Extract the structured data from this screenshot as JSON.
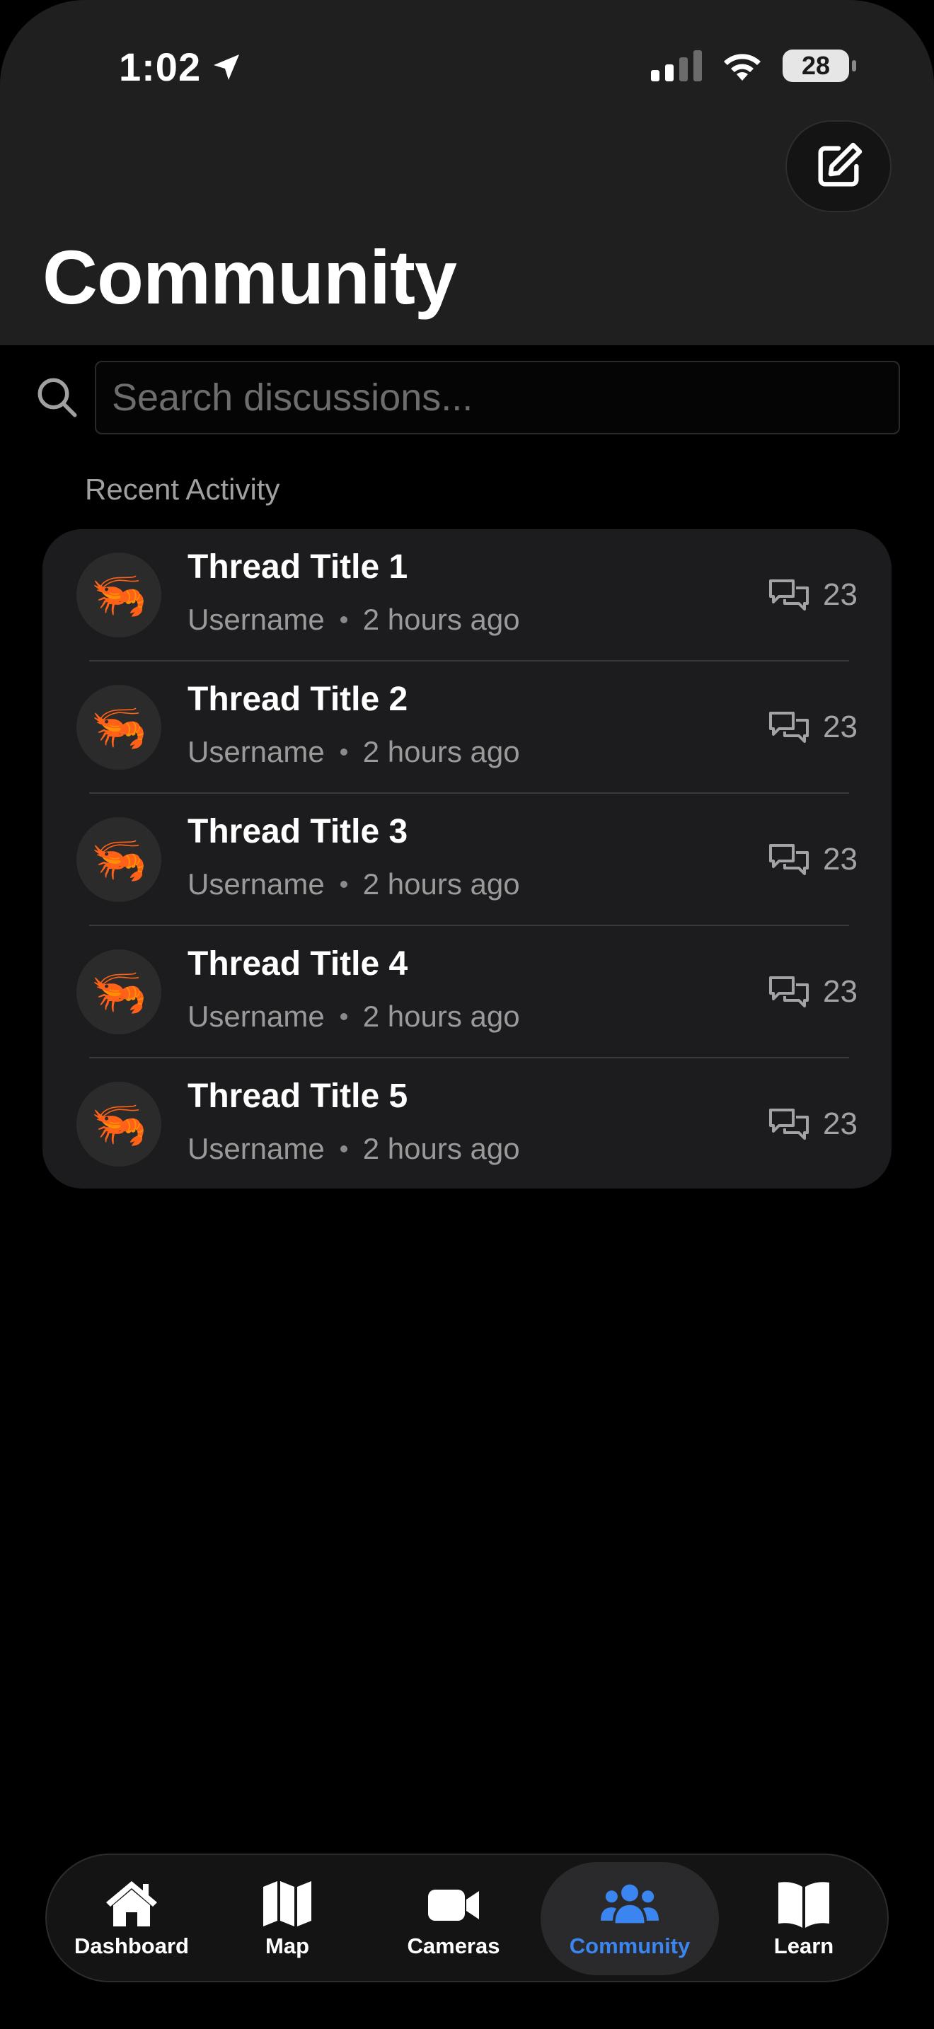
{
  "status_bar": {
    "time": "1:02",
    "battery_level": "28"
  },
  "header": {
    "title": "Community",
    "compose_icon": "compose-icon"
  },
  "search": {
    "placeholder": "Search discussions..."
  },
  "section": {
    "label": "Recent Activity"
  },
  "threads": [
    {
      "title": "Thread Title 1",
      "username": "Username",
      "time": "2 hours ago",
      "replies": "23",
      "avatar": "🦐"
    },
    {
      "title": "Thread Title 2",
      "username": "Username",
      "time": "2 hours ago",
      "replies": "23",
      "avatar": "🦐"
    },
    {
      "title": "Thread Title 3",
      "username": "Username",
      "time": "2 hours ago",
      "replies": "23",
      "avatar": "🦐"
    },
    {
      "title": "Thread Title 4",
      "username": "Username",
      "time": "2 hours ago",
      "replies": "23",
      "avatar": "🦐"
    },
    {
      "title": "Thread Title 5",
      "username": "Username",
      "time": "2 hours ago",
      "replies": "23",
      "avatar": "🦐"
    }
  ],
  "tabbar": {
    "tabs": [
      {
        "label": "Dashboard",
        "icon": "house-icon"
      },
      {
        "label": "Map",
        "icon": "map-icon"
      },
      {
        "label": "Cameras",
        "icon": "video-camera-icon"
      },
      {
        "label": "Community",
        "icon": "people-icon",
        "active": true
      },
      {
        "label": "Learn",
        "icon": "book-icon"
      }
    ]
  },
  "colors": {
    "accent": "#3a85f0",
    "background": "#000000",
    "header_bg": "#1f1f1f",
    "card_bg": "#1c1c1e",
    "secondary_text": "#9a9a9a"
  }
}
